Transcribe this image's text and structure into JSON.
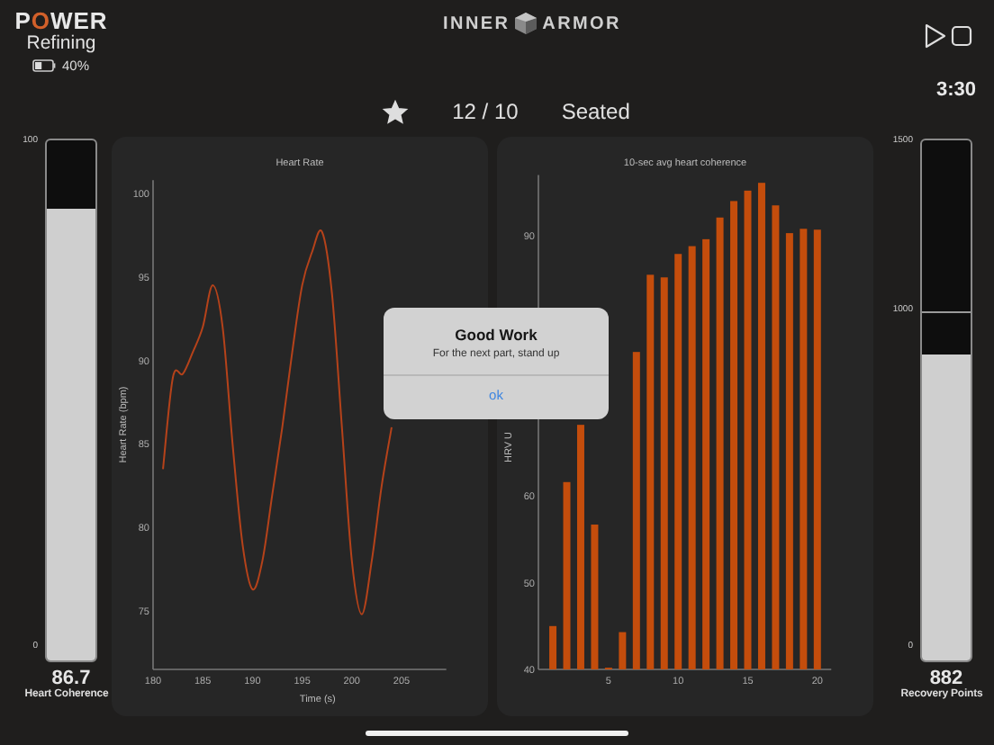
{
  "header": {
    "brand": {
      "before": "P",
      "accent": "O",
      "after": "WER"
    },
    "mode": "Refining",
    "battery": {
      "level": 0.4,
      "reading": "40%"
    },
    "logo": {
      "left": "INNER",
      "right": "ARMOR"
    }
  },
  "session": {
    "starred": true,
    "progress": "12 / 10",
    "position": "Seated",
    "timer": "3:30"
  },
  "gauges": [
    {
      "ticks": [
        "100",
        "0"
      ],
      "level": 0.867,
      "value": "86.7",
      "label": "Heart Coherence"
    },
    {
      "ticks": [
        "1500",
        "1000",
        "0"
      ],
      "level": 0.588,
      "value": "882",
      "label": "Recovery Points"
    }
  ],
  "charts": [
    {
      "chart_data": {
        "type": "line",
        "title": "Heart Rate",
        "xlabel": "Time (s)",
        "ylabel": "Heart Rate (bpm)",
        "xlim": [
          180,
          209.5
        ],
        "ylim": [
          71.5,
          100.8
        ],
        "xticks": [
          180,
          185,
          190,
          195,
          200,
          205
        ],
        "yticks": [
          75,
          80,
          85,
          90,
          95,
          100
        ],
        "x": [
          181,
          182,
          183,
          184,
          185,
          186,
          187,
          188,
          189,
          190,
          191,
          192,
          193,
          194,
          195,
          196,
          197,
          198,
          199,
          200,
          201,
          202,
          203,
          204
        ],
        "series": [
          {
            "color": "#b5421a",
            "values": [
              83.5,
              89,
              89.2,
              90.5,
              92,
              94.5,
              92,
              85,
              79,
              76.3,
              78,
              82,
              86,
              90.5,
              94.5,
              96.5,
              97.7,
              94,
              86,
              78,
              74.8,
              78,
              82.5,
              86
            ]
          }
        ]
      }
    },
    {
      "chart_data": {
        "type": "bar",
        "title": "10-sec avg heart coherence",
        "ylabel": "HRV U",
        "xlim": [
          0,
          21
        ],
        "ylim": [
          40,
          97
        ],
        "xticks": [
          5,
          10,
          15,
          20
        ],
        "yticks": [
          40,
          50,
          60,
          90
        ],
        "x": [
          1,
          2,
          3,
          4,
          5,
          6,
          7,
          8,
          9,
          10,
          11,
          12,
          13,
          14,
          15,
          16,
          17,
          18,
          19,
          20
        ],
        "series": [
          {
            "color": "#c44d0c",
            "values": [
              45,
              61.6,
              68.2,
              56.7,
              40.2,
              44.3,
              76.6,
              85.5,
              85.2,
              87.9,
              88.8,
              89.6,
              92.1,
              94,
              95.2,
              96.1,
              93.5,
              90.3,
              90.8,
              90.7
            ]
          }
        ]
      }
    }
  ],
  "dialog": {
    "title": "Good Work",
    "message": "For the next part, stand up",
    "button": "ok"
  }
}
